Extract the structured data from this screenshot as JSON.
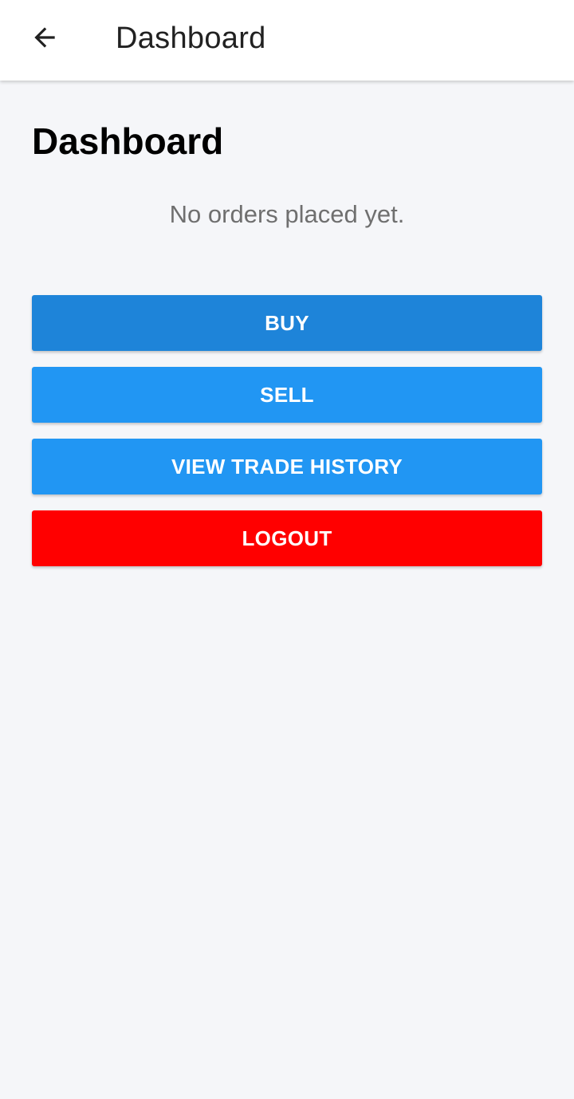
{
  "appbar": {
    "back_icon": "arrow-left-icon",
    "title": "Dashboard"
  },
  "main": {
    "heading": "Dashboard",
    "empty_message": "No orders placed yet."
  },
  "actions": {
    "buy_label": "BUY",
    "sell_label": "SELL",
    "history_label": "VIEW TRADE HISTORY",
    "logout_label": "LOGOUT"
  },
  "colors": {
    "buy": "#1e84d9",
    "primary": "#2196f3",
    "danger": "#ff0000",
    "background": "#f5f6f9"
  }
}
